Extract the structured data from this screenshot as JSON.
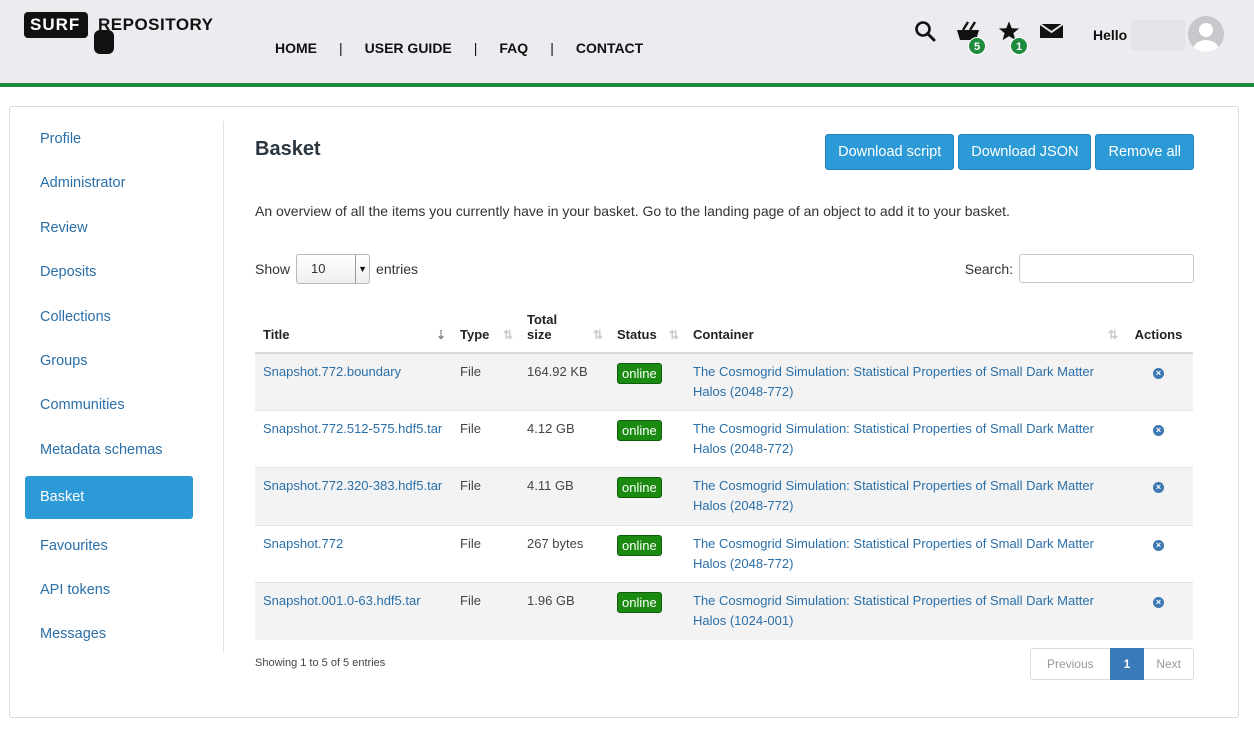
{
  "brand": {
    "surf": "SURF",
    "repository": "REPOSITORY"
  },
  "nav": {
    "items": [
      "HOME",
      "USER GUIDE",
      "FAQ",
      "CONTACT"
    ],
    "separator": "|"
  },
  "header": {
    "basket_count": "5",
    "favourites_count": "1",
    "hello": "Hello"
  },
  "sidebar": {
    "items": [
      "Profile",
      "Administrator",
      "Review",
      "Deposits",
      "Collections",
      "Groups",
      "Communities",
      "Metadata schemas",
      "Basket",
      "Favourites",
      "API tokens",
      "Messages"
    ],
    "active": "Basket"
  },
  "page": {
    "title": "Basket",
    "intro": "An overview of all the items you currently have in your basket. Go to the landing page of an object to add it to your basket.",
    "buttons": {
      "download_script": "Download script",
      "download_json": "Download JSON",
      "remove_all": "Remove all"
    }
  },
  "controls": {
    "show_label": "Show",
    "page_size": "10",
    "entries_label": "entries",
    "search_label": "Search:"
  },
  "table": {
    "columns": {
      "title": "Title",
      "type": "Type",
      "size_line1": "Total",
      "size_line2": "size",
      "status": "Status",
      "container": "Container",
      "actions": "Actions"
    },
    "rows": [
      {
        "title": "Snapshot.772.boundary",
        "type": "File",
        "size": "164.92 KB",
        "status": "online",
        "container_line1": "The Cosmogrid Simulation: Statistical Properties of Small Dark Matter",
        "container_line2": "Halos (2048-772)"
      },
      {
        "title": "Snapshot.772.512-575.hdf5.tar",
        "type": "File",
        "size": "4.12 GB",
        "status": "online",
        "container_line1": "The Cosmogrid Simulation: Statistical Properties of Small Dark Matter",
        "container_line2": "Halos (2048-772)"
      },
      {
        "title": "Snapshot.772.320-383.hdf5.tar",
        "type": "File",
        "size": "4.11 GB",
        "status": "online",
        "container_line1": "The Cosmogrid Simulation: Statistical Properties of Small Dark Matter",
        "container_line2": "Halos (2048-772)"
      },
      {
        "title": "Snapshot.772",
        "type": "File",
        "size": "267 bytes",
        "status": "online",
        "container_line1": "The Cosmogrid Simulation: Statistical Properties of Small Dark Matter",
        "container_line2": "Halos (2048-772)"
      },
      {
        "title": "Snapshot.001.0-63.hdf5.tar",
        "type": "File",
        "size": "1.96 GB",
        "status": "online",
        "container_line1": "The Cosmogrid Simulation: Statistical Properties of Small Dark Matter",
        "container_line2": "Halos (1024-001)"
      }
    ]
  },
  "footer": {
    "info": "Showing 1 to 5 of 5 entries",
    "previous": "Previous",
    "current_page": "1",
    "next": "Next"
  },
  "colors": {
    "accent": "#2c9ad6",
    "brand_green": "#1f8b3d",
    "status_online": "#1a8a10",
    "link": "#2a6fa8"
  },
  "icons": [
    "search-icon",
    "basket-icon",
    "star-icon",
    "mail-icon",
    "avatar-icon",
    "sort-icon",
    "remove-icon"
  ]
}
